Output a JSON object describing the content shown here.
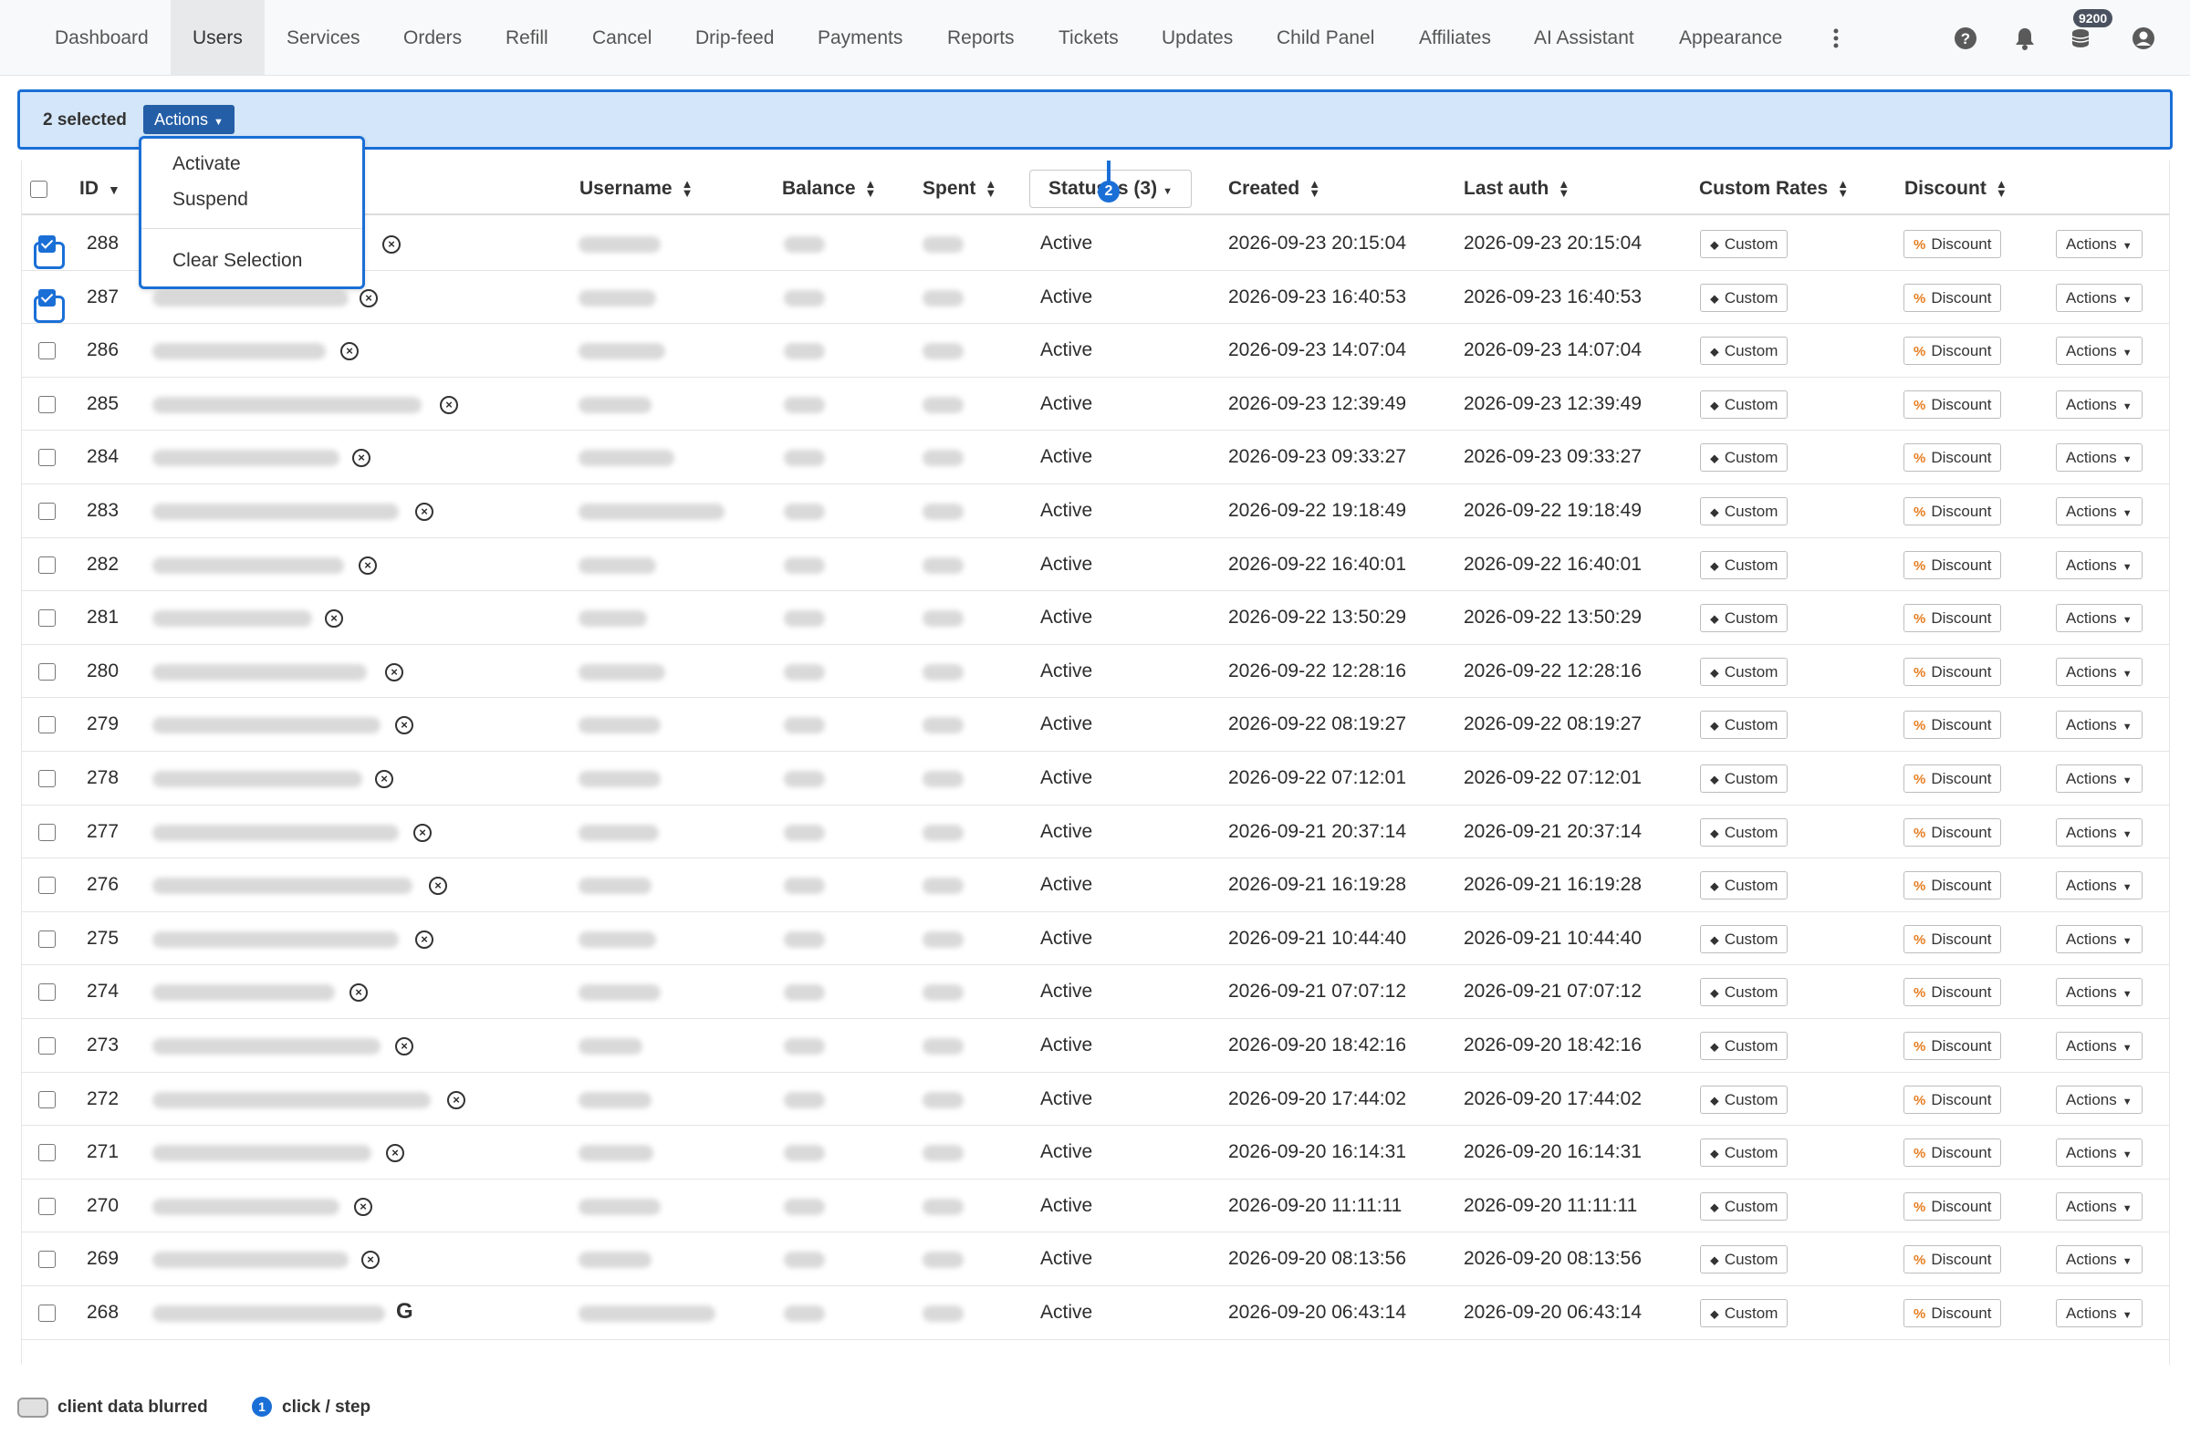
{
  "nav": {
    "items": [
      "Dashboard",
      "Users",
      "Services",
      "Orders",
      "Refill",
      "Cancel",
      "Drip-feed",
      "Payments",
      "Reports",
      "Tickets",
      "Updates",
      "Child Panel",
      "Affiliates",
      "AI Assistant",
      "Appearance"
    ],
    "active": "Users",
    "balance_badge": "9200",
    "icons": [
      "more-vertical-icon",
      "help-icon",
      "bell-icon",
      "coins-icon",
      "account-icon"
    ]
  },
  "selection": {
    "count_label": "2 selected",
    "actions_label": "Actions"
  },
  "dropdown": {
    "items": [
      "Activate",
      "Suspend",
      "Clear Selection"
    ]
  },
  "table": {
    "headers": {
      "id": "ID",
      "username": "Username",
      "balance": "Balance",
      "spent": "Spent",
      "status_filter": "Statuses (3)",
      "created": "Created",
      "last_auth": "Last auth",
      "custom_rates": "Custom Rates",
      "discount": "Discount"
    },
    "button_labels": {
      "custom": "Custom",
      "discount": "Discount",
      "actions": "Actions"
    },
    "rows": [
      {
        "id": "288",
        "status": "Active",
        "created": "2026-09-23 20:15:04",
        "last_auth": "2026-09-23 20:15:04",
        "checked": true
      },
      {
        "id": "287",
        "status": "Active",
        "created": "2026-09-23 16:40:53",
        "last_auth": "2026-09-23 16:40:53",
        "checked": true
      },
      {
        "id": "286",
        "status": "Active",
        "created": "2026-09-23 14:07:04",
        "last_auth": "2026-09-23 14:07:04",
        "checked": false
      },
      {
        "id": "285",
        "status": "Active",
        "created": "2026-09-23 12:39:49",
        "last_auth": "2026-09-23 12:39:49",
        "checked": false
      },
      {
        "id": "284",
        "status": "Active",
        "created": "2026-09-23 09:33:27",
        "last_auth": "2026-09-23 09:33:27",
        "checked": false
      },
      {
        "id": "283",
        "status": "Active",
        "created": "2026-09-22 19:18:49",
        "last_auth": "2026-09-22 19:18:49",
        "checked": false
      },
      {
        "id": "282",
        "status": "Active",
        "created": "2026-09-22 16:40:01",
        "last_auth": "2026-09-22 16:40:01",
        "checked": false
      },
      {
        "id": "281",
        "status": "Active",
        "created": "2026-09-22 13:50:29",
        "last_auth": "2026-09-22 13:50:29",
        "checked": false
      },
      {
        "id": "280",
        "status": "Active",
        "created": "2026-09-22 12:28:16",
        "last_auth": "2026-09-22 12:28:16",
        "checked": false
      },
      {
        "id": "279",
        "status": "Active",
        "created": "2026-09-22 08:19:27",
        "last_auth": "2026-09-22 08:19:27",
        "checked": false
      },
      {
        "id": "278",
        "status": "Active",
        "created": "2026-09-22 07:12:01",
        "last_auth": "2026-09-22 07:12:01",
        "checked": false
      },
      {
        "id": "277",
        "status": "Active",
        "created": "2026-09-21 20:37:14",
        "last_auth": "2026-09-21 20:37:14",
        "checked": false
      },
      {
        "id": "276",
        "status": "Active",
        "created": "2026-09-21 16:19:28",
        "last_auth": "2026-09-21 16:19:28",
        "checked": false
      },
      {
        "id": "275",
        "status": "Active",
        "created": "2026-09-21 10:44:40",
        "last_auth": "2026-09-21 10:44:40",
        "checked": false
      },
      {
        "id": "274",
        "status": "Active",
        "created": "2026-09-21 07:07:12",
        "last_auth": "2026-09-21 07:07:12",
        "checked": false
      },
      {
        "id": "273",
        "status": "Active",
        "created": "2026-09-20 18:42:16",
        "last_auth": "2026-09-20 18:42:16",
        "checked": false
      },
      {
        "id": "272",
        "status": "Active",
        "created": "2026-09-20 17:44:02",
        "last_auth": "2026-09-20 17:44:02",
        "checked": false
      },
      {
        "id": "271",
        "status": "Active",
        "created": "2026-09-20 16:14:31",
        "last_auth": "2026-09-20 16:14:31",
        "checked": false
      },
      {
        "id": "270",
        "status": "Active",
        "created": "2026-09-20 11:11:11",
        "last_auth": "2026-09-20 11:11:11",
        "checked": false
      },
      {
        "id": "269",
        "status": "Active",
        "created": "2026-09-20 08:13:56",
        "last_auth": "2026-09-20 08:13:56",
        "checked": false
      },
      {
        "id": "268",
        "status": "Active",
        "created": "2026-09-20 06:43:14",
        "last_auth": "2026-09-20 06:43:14",
        "checked": false,
        "login_icon": "google-icon"
      }
    ]
  },
  "legend": {
    "blurred_label": "client data blurred",
    "step_number": "1",
    "step_label": "click / step"
  },
  "annotation": {
    "step_number": "2"
  },
  "colors": {
    "accent": "#1a6fd6",
    "selection_bar_bg": "#d4e6f9",
    "actions_button_bg": "#245ea6",
    "discount_icon": "#e67e22"
  }
}
